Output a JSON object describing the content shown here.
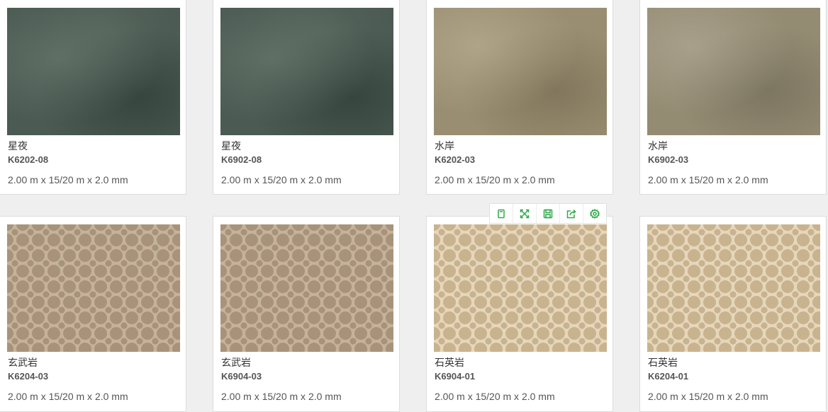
{
  "products": [
    {
      "name": "星夜",
      "code": "K6202-08",
      "dims": "2.00 m x 15/20 m x 2.0 mm",
      "texture": "dark-green"
    },
    {
      "name": "星夜",
      "code": "K6902-08",
      "dims": "2.00 m x 15/20 m x 2.0 mm",
      "texture": "dark-green"
    },
    {
      "name": "水岸",
      "code": "K6202-03",
      "dims": "2.00 m x 15/20 m x 2.0 mm",
      "texture": "tan"
    },
    {
      "name": "水岸",
      "code": "K6902-03",
      "dims": "2.00 m x 15/20 m x 2.0 mm",
      "texture": "tan"
    },
    {
      "name": "玄武岩",
      "code": "K6204-03",
      "dims": "2.00 m x 15/20 m x 2.0 mm",
      "texture": "clover-taupe"
    },
    {
      "name": "玄武岩",
      "code": "K6904-03",
      "dims": "2.00 m x 15/20 m x 2.0 mm",
      "texture": "clover-taupe"
    },
    {
      "name": "石英岩",
      "code": "K6904-01",
      "dims": "2.00 m x 15/20 m x 2.0 mm",
      "texture": "clover-beige"
    },
    {
      "name": "石英岩",
      "code": "K6204-01",
      "dims": "2.00 m x 15/20 m x 2.0 mm",
      "texture": "clover-beige"
    }
  ],
  "toolbar": {
    "icons": [
      "copy-icon",
      "expand-icon",
      "save-icon",
      "share-icon",
      "settings-icon"
    ],
    "accent_color": "#2eaa4a"
  }
}
